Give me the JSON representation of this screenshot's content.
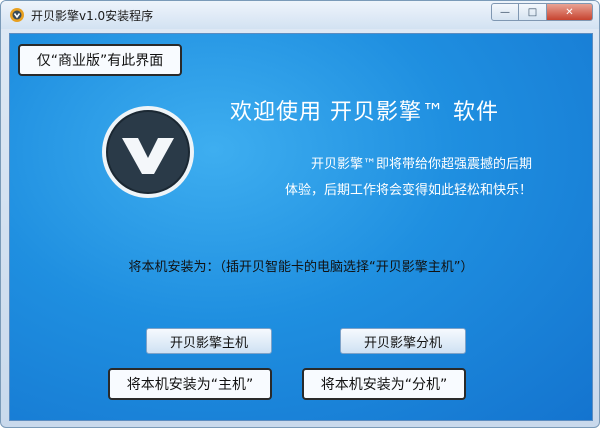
{
  "window": {
    "title": "开贝影擎v1.0安装程序",
    "controls": {
      "minimize": "—",
      "maximize": "□",
      "close": "✕"
    }
  },
  "callouts": {
    "commercial": "仅“商业版”有此界面",
    "host_hint": "将本机安装为“主机”",
    "slave_hint": "将本机安装为“分机”"
  },
  "main": {
    "welcome": "欢迎使用 开贝影擎™ 软件",
    "description_line1": "开贝影擎™即将带给你超强震撼的后期",
    "description_line2": "体验，后期工作将会变得如此轻松和快乐！",
    "prompt": "将本机安装为：（插开贝智能卡的电脑选择“开贝影擎主机”）"
  },
  "buttons": {
    "host": "开贝影擎主机",
    "slave": "开贝影擎分机"
  },
  "colors": {
    "content_bg": "#1f8fe0",
    "accent_logo": "#2a3a48"
  }
}
